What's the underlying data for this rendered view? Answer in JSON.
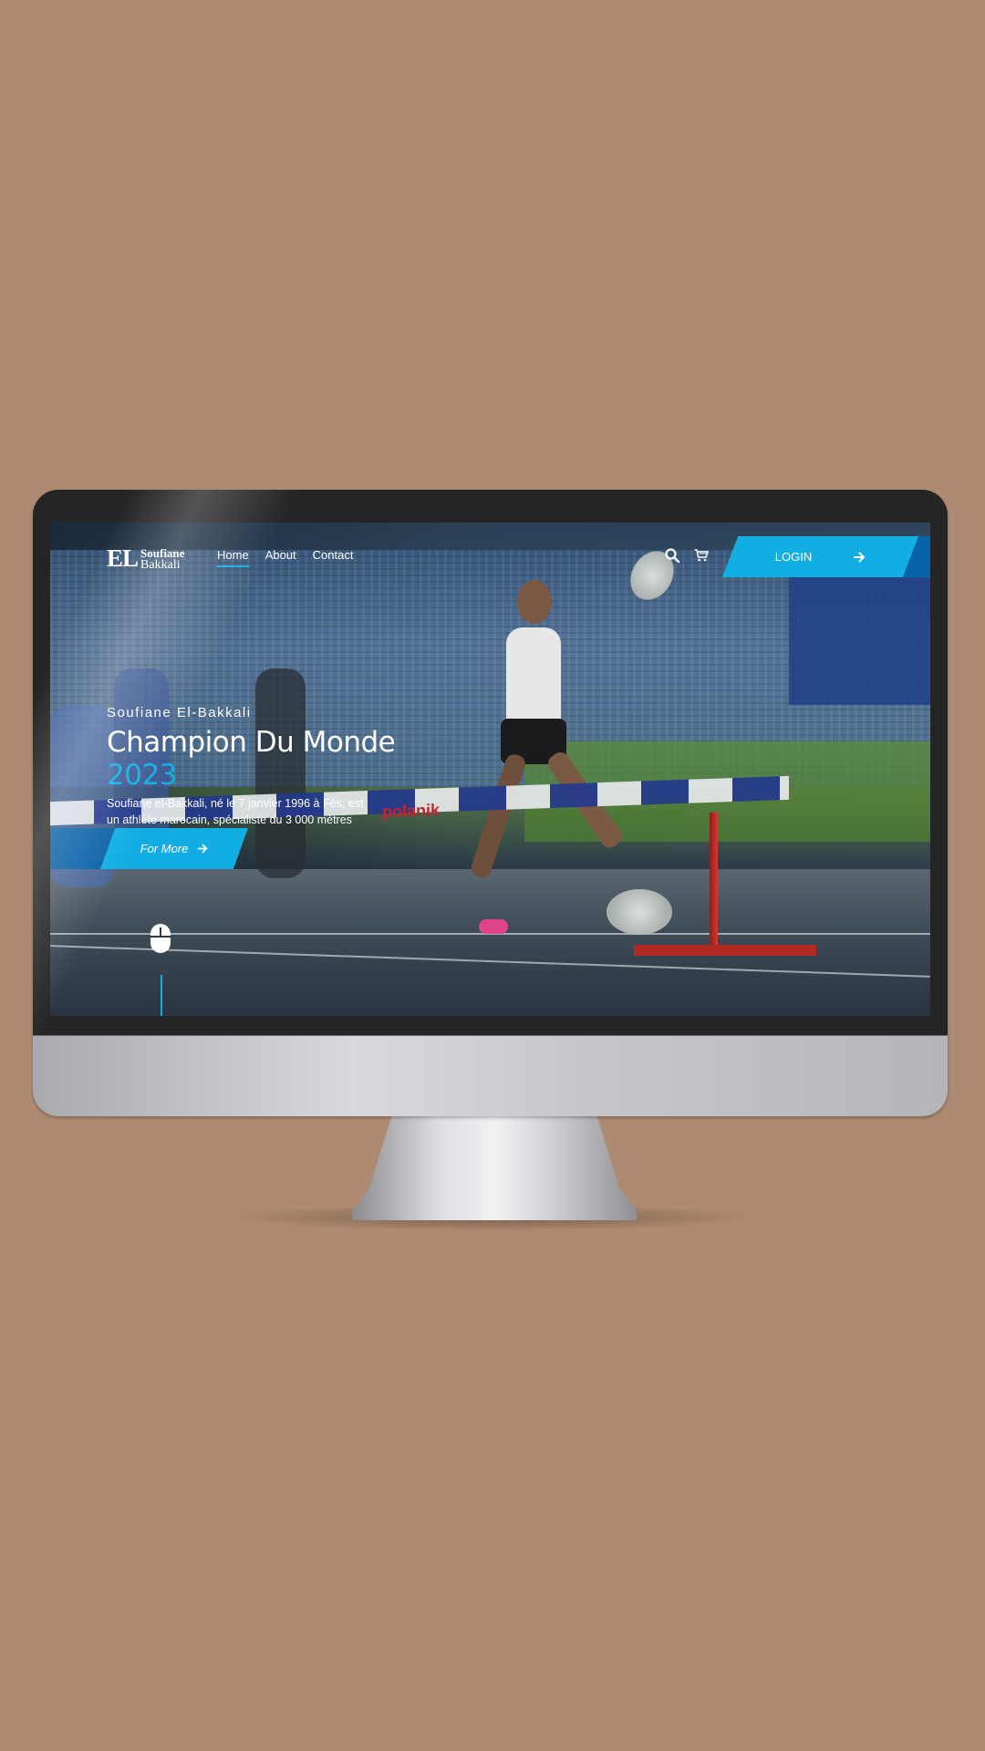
{
  "brand": {
    "logo_initials": "EL",
    "logo_first": "Soufiane",
    "logo_last": "Bakkali"
  },
  "nav": {
    "links": [
      {
        "label": "Home",
        "active": true
      },
      {
        "label": "About",
        "active": false
      },
      {
        "label": "Contact",
        "active": false
      }
    ],
    "search_icon": "search-icon",
    "cart_icon": "cart-icon",
    "login_label": "LOGIN",
    "login_icon": "arrow-right-icon"
  },
  "hero": {
    "kicker": "Soufiane El-Bakkali",
    "title_main": "Champion Du Monde",
    "title_year": "2023",
    "description": "Soufiane el-Bakkali, né le 7 janvier 1996 à Fès, est un athlète marocain, spécialiste du 3 000 mètres steeple.",
    "cta_label": "For More",
    "cta_icon": "arrow-right-icon"
  },
  "photo": {
    "hurdle_brand": "polanik"
  },
  "colors": {
    "accent": "#12aee3",
    "accent_dark": "#0a62a8",
    "background": "#ae8a71"
  }
}
